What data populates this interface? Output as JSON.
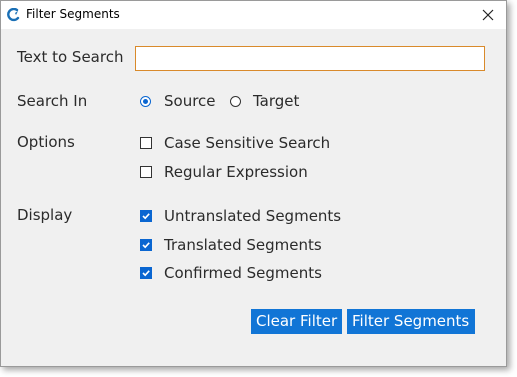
{
  "window": {
    "title": "Filter Segments",
    "close_glyph": "✕"
  },
  "form": {
    "text_to_search": {
      "label": "Text to Search",
      "value": "",
      "placeholder": ""
    },
    "search_in": {
      "label": "Search In",
      "options": [
        {
          "label": "Source",
          "checked": true
        },
        {
          "label": "Target",
          "checked": false
        }
      ]
    },
    "options": {
      "label": "Options",
      "items": [
        {
          "label": "Case Sensitive Search",
          "checked": false
        },
        {
          "label": "Regular Expression",
          "checked": false
        }
      ]
    },
    "display": {
      "label": "Display",
      "items": [
        {
          "label": "Untranslated Segments",
          "checked": true
        },
        {
          "label": "Translated Segments",
          "checked": true
        },
        {
          "label": "Confirmed Segments",
          "checked": true
        }
      ]
    }
  },
  "buttons": {
    "clear_filter": "Clear Filter",
    "filter_segments": "Filter Segments"
  },
  "colors": {
    "accent": "#1175d6",
    "input_border": "#d98a2b",
    "dialog_bg": "#f0f0f0"
  },
  "icons": {
    "app": "app-logo-icon",
    "close": "close-icon",
    "check": "checkmark-icon"
  }
}
